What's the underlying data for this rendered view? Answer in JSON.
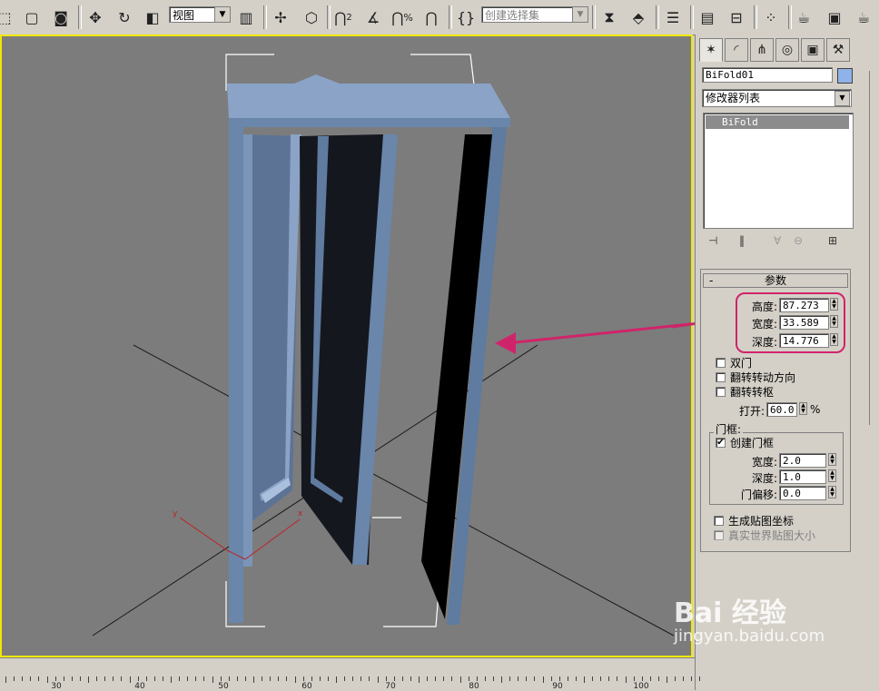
{
  "toolbar": {
    "view_combo": "视图",
    "selection_set_placeholder": "创建选择集",
    "percent_label": "%",
    "snap_label": "2",
    "icons": [
      "select-icon",
      "region-select-icon",
      "window-crossing-icon",
      "move-icon",
      "rotate-icon",
      "scale-icon",
      "mirror-icon",
      "align-icon",
      "pivot-icon",
      "snap-icon",
      "angle-snap-icon",
      "percent-snap-icon",
      "spinner-snap-icon",
      "named-selection-icon",
      "layer-manager-icon",
      "curve-editor-icon",
      "schematic-icon",
      "material-editor-icon",
      "render-scene-icon",
      "quick-render-icon"
    ]
  },
  "viewport": {
    "border_color": "#f0e800",
    "background": "#7c7c7c",
    "axis_x": "x",
    "axis_y": "y"
  },
  "command_panel": {
    "object_name": "BiFold01",
    "object_color": "#8fb3e8",
    "modifier_list": "修改器列表",
    "stack_items": [
      "BiFold"
    ],
    "rollout_title": "参数",
    "rollout_toggle": "-",
    "params": [
      {
        "label": "高度:",
        "value": "87.273"
      },
      {
        "label": "宽度:",
        "value": "33.589"
      },
      {
        "label": "深度:",
        "value": "14.776"
      }
    ],
    "checkboxes": [
      {
        "label": "双门",
        "checked": false
      },
      {
        "label": "翻转转动方向",
        "checked": false
      },
      {
        "label": "翻转转枢",
        "checked": false
      }
    ],
    "open_label": "打开:",
    "open_value": "60.0",
    "open_unit": "%",
    "frame_group_title": "门框:",
    "create_frame": {
      "label": "创建门框",
      "checked": true,
      "mark": "✔"
    },
    "frame_params": [
      {
        "label": "宽度:",
        "value": "2.0"
      },
      {
        "label": "深度:",
        "value": "1.0"
      },
      {
        "label": "门偏移:",
        "value": "0.0"
      }
    ],
    "mapping": [
      {
        "label": "生成贴图坐标",
        "checked": false,
        "disabled": false
      },
      {
        "label": "真实世界贴图大小",
        "checked": false,
        "disabled": true
      }
    ]
  },
  "timeline": {
    "ticks": [
      "30",
      "40",
      "50",
      "60",
      "70",
      "80",
      "90",
      "100"
    ]
  },
  "watermark": {
    "logo": "Bai 经验",
    "url": "jingyan.baidu.com"
  },
  "colors": {
    "highlight": "#d0246a",
    "door_blue": "#6a86aa",
    "door_dark": "#15171f"
  }
}
